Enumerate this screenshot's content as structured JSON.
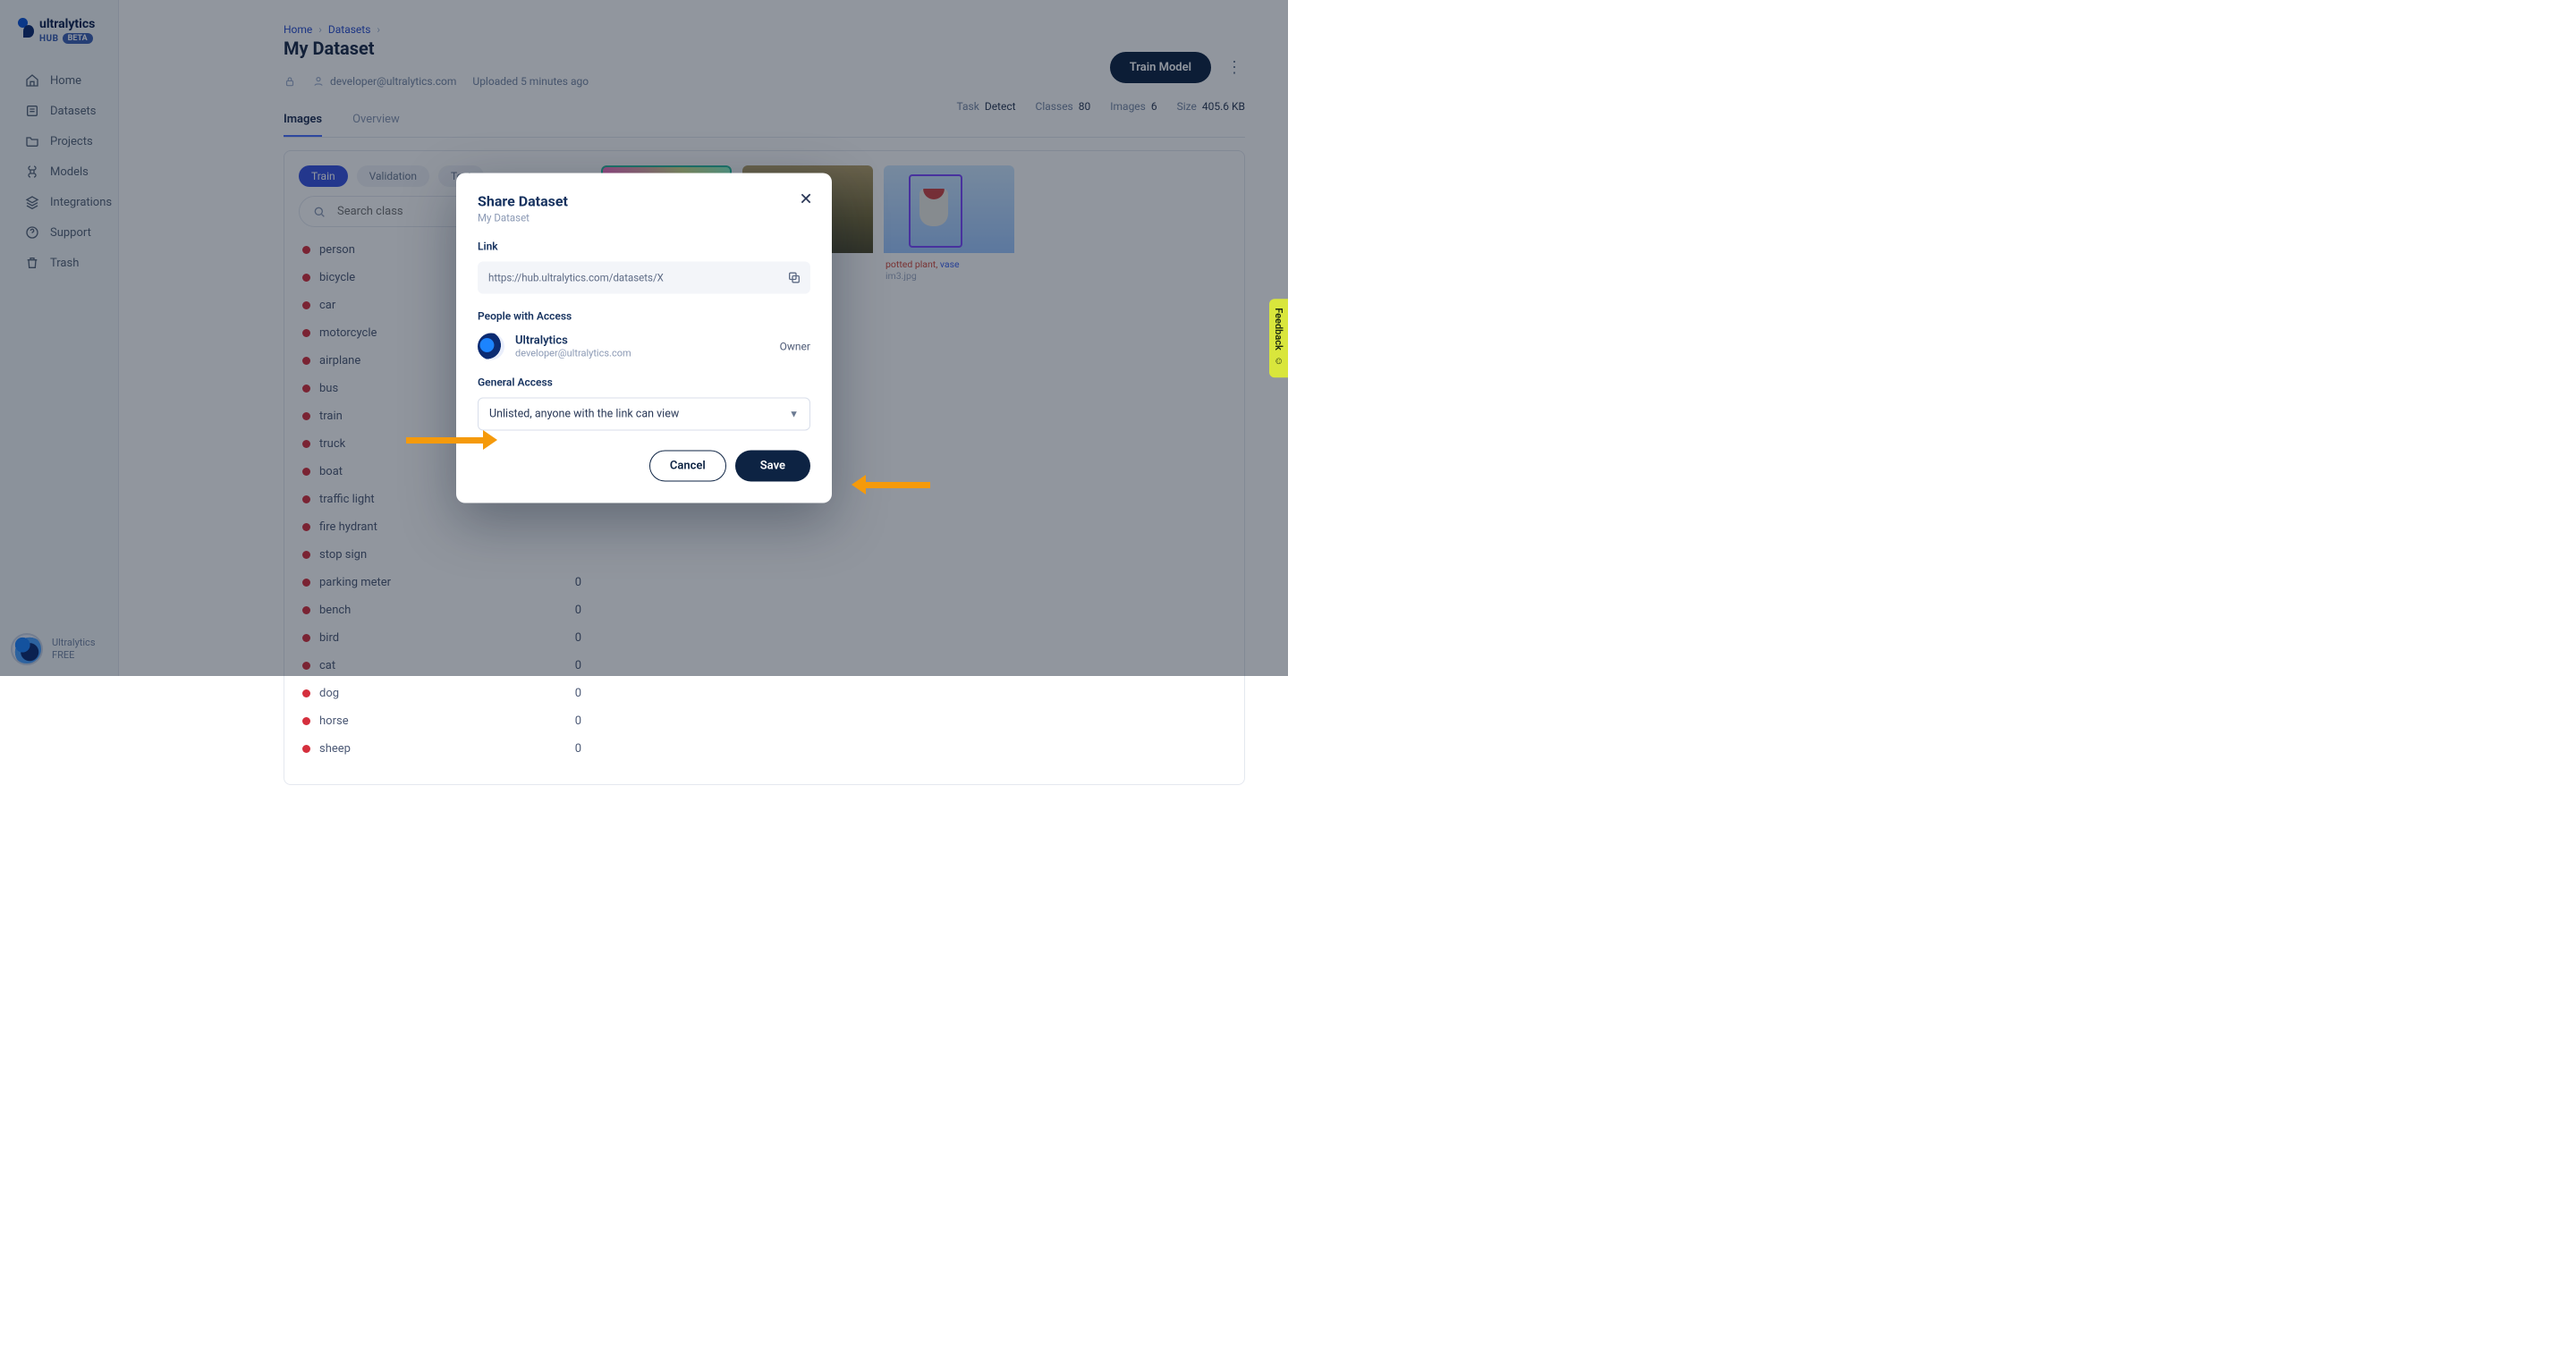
{
  "brand": {
    "name": "ultralytics",
    "hub": "HUB",
    "badge": "BETA"
  },
  "sidebar": {
    "items": [
      {
        "label": "Home",
        "icon": "home"
      },
      {
        "label": "Datasets",
        "icon": "stack"
      },
      {
        "label": "Projects",
        "icon": "folder"
      },
      {
        "label": "Models",
        "icon": "command"
      },
      {
        "label": "Integrations",
        "icon": "layers"
      },
      {
        "label": "Support",
        "icon": "help"
      },
      {
        "label": "Trash",
        "icon": "trash"
      }
    ],
    "footer": {
      "name": "Ultralytics",
      "plan": "FREE"
    }
  },
  "breadcrumbs": {
    "home": "Home",
    "datasets": "Datasets"
  },
  "page": {
    "title": "My Dataset"
  },
  "actions": {
    "trainModel": "Train Model"
  },
  "meta": {
    "owner": "developer@ultralytics.com",
    "uploaded": "Uploaded 5 minutes ago"
  },
  "stats": {
    "taskLabel": "Task",
    "task": "Detect",
    "classesLabel": "Classes",
    "classes": "80",
    "imagesLabel": "Images",
    "images": "6",
    "sizeLabel": "Size",
    "size": "405.6 KB"
  },
  "tabs": {
    "images": "Images",
    "overview": "Overview"
  },
  "splits": {
    "train": "Train",
    "validation": "Validation",
    "test": "Test"
  },
  "search": {
    "placeholder": "Search class"
  },
  "classes": [
    {
      "name": "person"
    },
    {
      "name": "bicycle"
    },
    {
      "name": "car"
    },
    {
      "name": "motorcycle"
    },
    {
      "name": "airplane"
    },
    {
      "name": "bus"
    },
    {
      "name": "train"
    },
    {
      "name": "truck"
    },
    {
      "name": "boat"
    },
    {
      "name": "traffic light"
    },
    {
      "name": "fire hydrant"
    },
    {
      "name": "stop sign"
    },
    {
      "name": "parking meter",
      "count": "0"
    },
    {
      "name": "bench",
      "count": "0"
    },
    {
      "name": "bird",
      "count": "0"
    },
    {
      "name": "cat",
      "count": "0"
    },
    {
      "name": "dog",
      "count": "0"
    },
    {
      "name": "horse",
      "count": "0"
    },
    {
      "name": "sheep",
      "count": "0"
    }
  ],
  "thumb3": {
    "tags": "potted plant,",
    "tag2": " vase",
    "file": "im3.jpg"
  },
  "modal": {
    "title": "Share Dataset",
    "subtitle": "My Dataset",
    "linkLabel": "Link",
    "link": "https://hub.ultralytics.com/datasets/X",
    "accessLabel": "People with Access",
    "person": {
      "name": "Ultralytics",
      "email": "developer@ultralytics.com",
      "role": "Owner"
    },
    "generalLabel": "General Access",
    "generalValue": "Unlisted, anyone with the link can view",
    "cancel": "Cancel",
    "save": "Save"
  },
  "feedback": {
    "label": "Feedback"
  }
}
